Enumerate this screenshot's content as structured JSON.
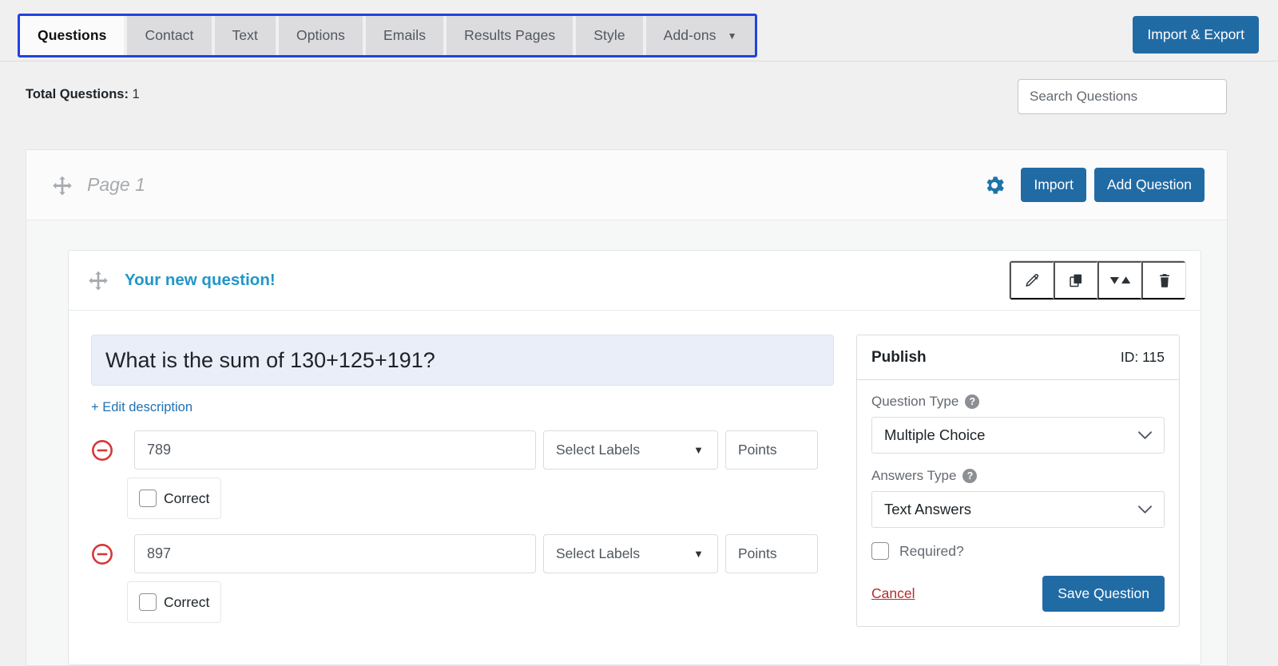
{
  "tabs": [
    {
      "label": "Questions",
      "active": true,
      "caret": false
    },
    {
      "label": "Contact",
      "active": false,
      "caret": false
    },
    {
      "label": "Text",
      "active": false,
      "caret": false
    },
    {
      "label": "Options",
      "active": false,
      "caret": false
    },
    {
      "label": "Emails",
      "active": false,
      "caret": false
    },
    {
      "label": "Results Pages",
      "active": false,
      "caret": false
    },
    {
      "label": "Style",
      "active": false,
      "caret": false
    },
    {
      "label": "Add-ons",
      "active": false,
      "caret": true
    }
  ],
  "header": {
    "import_export_label": "Import & Export"
  },
  "subheader": {
    "total_questions_label": "Total Questions:",
    "total_questions_count": "1",
    "search_placeholder": "Search Questions"
  },
  "page": {
    "title": "Page 1",
    "gear_icon": "gear-icon",
    "move_icon": "move-icon",
    "import_label": "Import",
    "add_question_label": "Add Question"
  },
  "question": {
    "header_title": "Your new question!",
    "actions": [
      {
        "name": "edit-question-button",
        "icon": "pencil-icon"
      },
      {
        "name": "duplicate-question-button",
        "icon": "copy-icon"
      },
      {
        "name": "sort-question-button",
        "icon": "sort-icon"
      },
      {
        "name": "delete-question-button",
        "icon": "trash-icon"
      }
    ],
    "title_value": "What is the sum of 130+125+191?",
    "edit_description_label": "+ Edit description",
    "answers": [
      {
        "value": "789",
        "labels_placeholder": "Select Labels",
        "points_placeholder": "Points",
        "correct_label": "Correct",
        "correct_checked": false
      },
      {
        "value": "897",
        "labels_placeholder": "Select Labels",
        "points_placeholder": "Points",
        "correct_label": "Correct",
        "correct_checked": false
      }
    ]
  },
  "publish": {
    "title": "Publish",
    "id_label": "ID: 115",
    "question_type_label": "Question Type",
    "question_type_value": "Multiple Choice",
    "answers_type_label": "Answers Type",
    "answers_type_value": "Text Answers",
    "required_label": "Required?",
    "required_checked": false,
    "cancel_label": "Cancel",
    "save_label": "Save Question"
  },
  "colors": {
    "accent_blue": "#216ba5",
    "link_blue": "#2271b1",
    "question_title_blue": "#2196c9",
    "focus_ring_blue": "#2142e0",
    "danger_red": "#b32d2e",
    "minus_red": "#d63638",
    "page_bg": "#f0f0f1"
  }
}
